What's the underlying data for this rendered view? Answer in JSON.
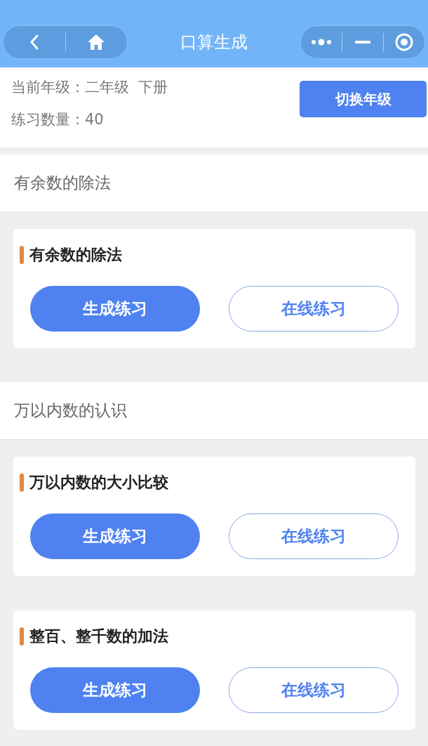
{
  "nav_bar": {
    "title": "口算生成"
  },
  "info": {
    "grade_label": "当前年级：二年级  下册",
    "count_label": "练习数量：40",
    "switch_button": "切换年级"
  },
  "sections": [
    {
      "title": "有余数的除法",
      "items": [
        {
          "title": "有余数的除法",
          "generate_button": "生成练习",
          "online_button": "在线练习"
        }
      ]
    },
    {
      "title": "万以内数的认识",
      "items": [
        {
          "title": "万以内数的大小比较",
          "generate_button": "生成练习",
          "online_button": "在线练习"
        },
        {
          "title": "整百、整千数的加法",
          "generate_button": "生成练习",
          "online_button": "在线练习"
        }
      ]
    }
  ]
}
